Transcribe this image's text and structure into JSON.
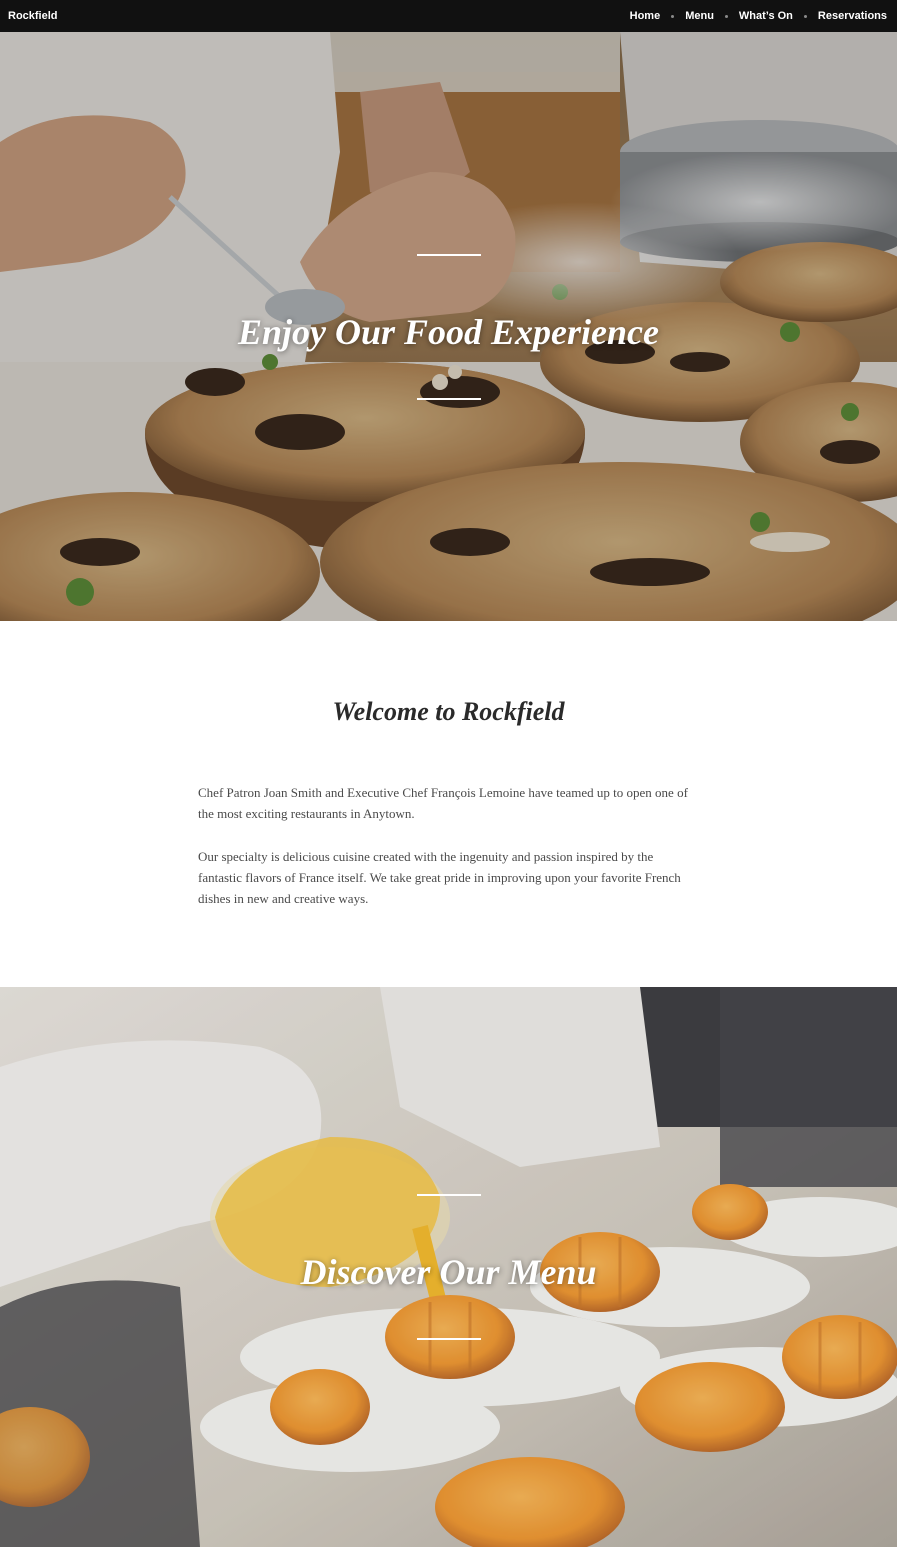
{
  "site": {
    "brand": "Rockfield"
  },
  "nav": {
    "items": [
      {
        "label": "Home"
      },
      {
        "label": "Menu"
      },
      {
        "label": "What’s On"
      },
      {
        "label": "Reservations"
      }
    ]
  },
  "hero1": {
    "title": "Enjoy Our Food Experience"
  },
  "welcome": {
    "heading": "Welcome to Rockfield",
    "paragraph1": "Chef Patron Joan Smith and Executive Chef François Lemoine have teamed up to open one of the most exciting restaurants in Anytown.",
    "paragraph2": "Our specialty is delicious cuisine created with the ingenuity and passion inspired by the fantastic flavors of France itself. We take great pride in improving upon your favorite French dishes in new and creative ways."
  },
  "hero2": {
    "title": "Discover Our Menu"
  },
  "colors": {
    "topbar": "#111111",
    "text_white": "#ffffff",
    "heading_dark": "#2a2a2a",
    "body_text": "#4a4a4a"
  }
}
